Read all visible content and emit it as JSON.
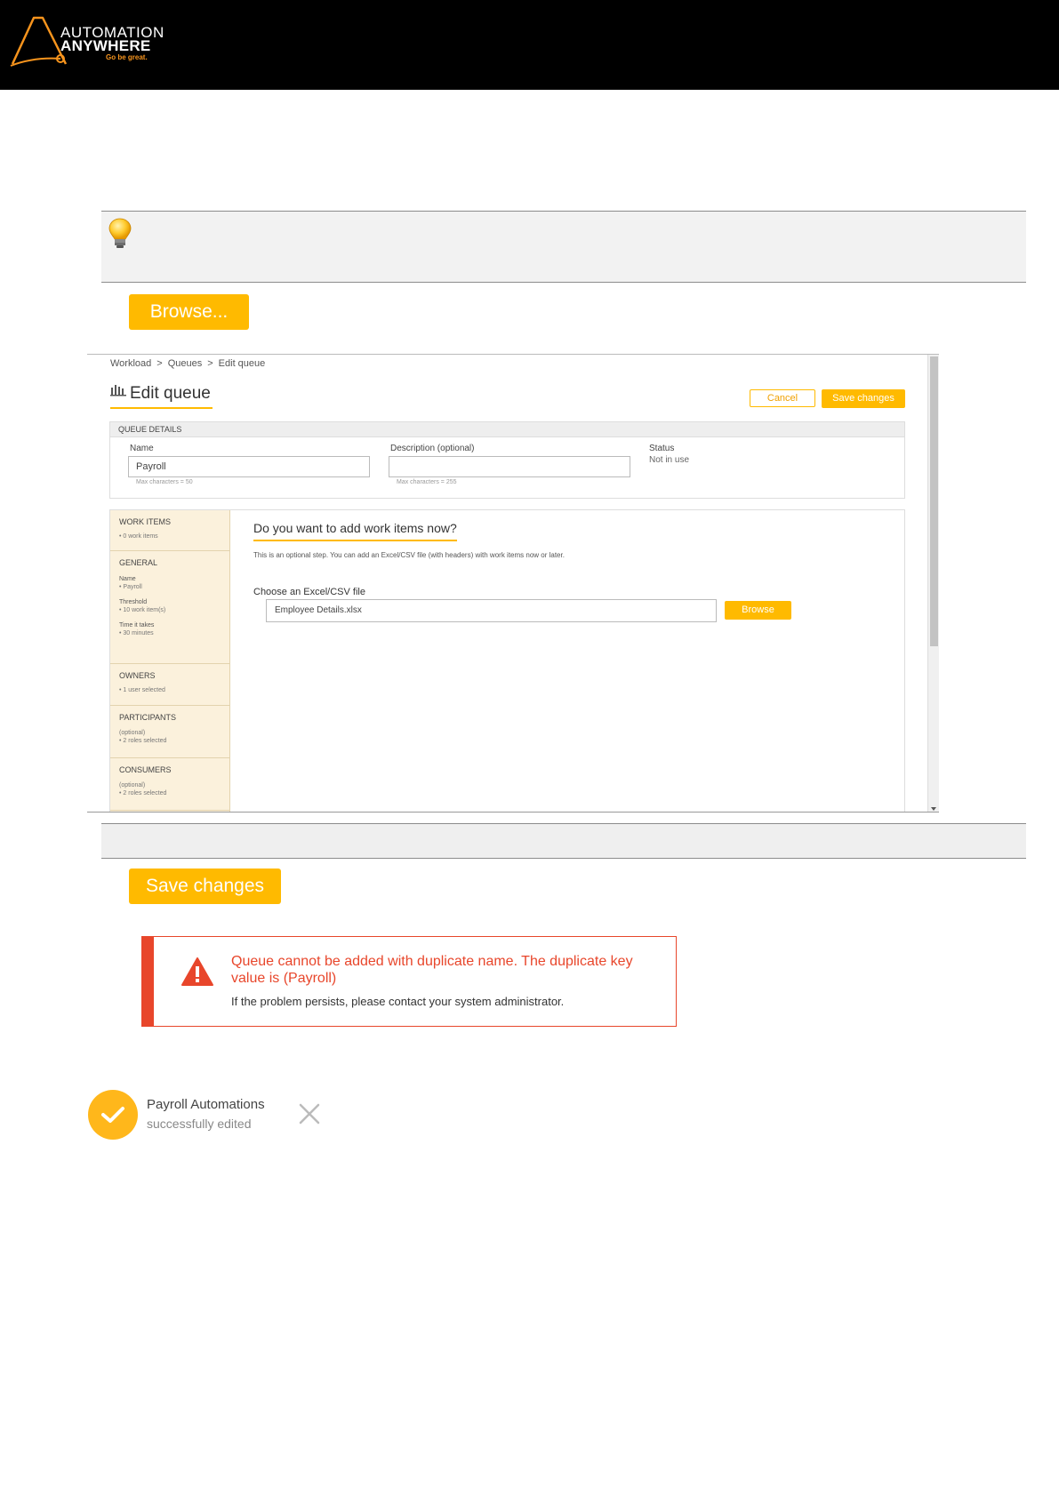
{
  "header": {
    "logo_line1": "AUTOMATION",
    "logo_line2": "ANYWHERE",
    "logo_tagline": "Go be great."
  },
  "tip": {
    "icon": "lightbulb-icon"
  },
  "buttons": {
    "browse_large": "Browse...",
    "save_large": "Save changes"
  },
  "screenshot": {
    "breadcrumb": [
      "Workload",
      ">",
      "Queues",
      ">",
      "Edit queue"
    ],
    "title": "Edit queue",
    "cancel_label": "Cancel",
    "save_label": "Save changes",
    "details": {
      "heading": "QUEUE DETAILS",
      "name_label": "Name",
      "name_value": "Payroll",
      "name_hint": "Max characters = 50",
      "description_label": "Description (optional)",
      "description_value": "",
      "description_hint": "Max characters = 255",
      "status_label": "Status",
      "status_value": "Not in use"
    },
    "nav": {
      "work_items": {
        "title": "WORK ITEMS",
        "sub": "• 0 work items"
      },
      "general": {
        "title": "GENERAL",
        "name_key": "Name",
        "name_val": "• Payroll",
        "threshold_key": "Threshold",
        "threshold_val": "• 10 work item(s)",
        "time_key": "Time it takes",
        "time_val": "• 30 minutes"
      },
      "owners": {
        "title": "OWNERS",
        "sub": "• 1 user selected"
      },
      "participants": {
        "title": "PARTICIPANTS",
        "opt": "(optional)",
        "sub": "• 2 roles selected"
      },
      "consumers": {
        "title": "CONSUMERS",
        "opt": "(optional)",
        "sub": "• 2 roles selected"
      }
    },
    "content": {
      "question": "Do you want to add work items now?",
      "description": "This is an optional step. You can add an Excel/CSV file (with headers) with work items now or later.",
      "file_label": "Choose an Excel/CSV file",
      "file_value": "Employee Details.xlsx",
      "browse_label": "Browse"
    }
  },
  "alert": {
    "title": "Queue cannot be added with duplicate name. The duplicate key value is (Payroll)",
    "message": "If the problem persists, please contact your system administrator.",
    "color": "#e8462b"
  },
  "toast": {
    "title": "Payroll Automations",
    "subtitle": "successfully edited"
  },
  "colors": {
    "accent": "#ffba00",
    "header_bg": "#000000",
    "logo_accent": "#f7941d"
  }
}
